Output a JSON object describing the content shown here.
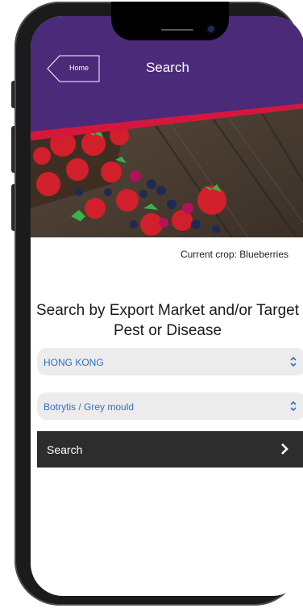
{
  "header": {
    "back_label": "Home",
    "title": "Search"
  },
  "current_crop": "Current crop: Blueberries",
  "headline": "Search by Export Market and/or Target Pest or Disease",
  "market_select": {
    "value": "HONG KONG"
  },
  "pest_select": {
    "value": "Botrytis / Grey mould"
  },
  "search_button": {
    "label": "Search"
  },
  "colors": {
    "header": "#4b2a7a",
    "accent": "#d4183c",
    "select_text": "#2f6fc4",
    "button_bg": "#2d2d2d"
  }
}
